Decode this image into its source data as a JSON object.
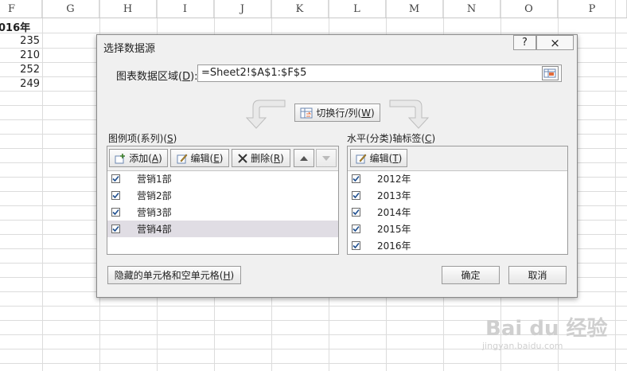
{
  "sheet": {
    "columns": [
      "F",
      "G",
      "H",
      "I",
      "J",
      "K",
      "L",
      "M",
      "N",
      "O",
      "P"
    ],
    "column_f_header": "016年",
    "column_f_values": [
      "235",
      "210",
      "252",
      "249"
    ]
  },
  "dialog": {
    "title": "选择数据源",
    "help_label": "?",
    "close_label": "×",
    "range_label_prefix": "图表数据区域(",
    "range_label_key": "D",
    "range_label_suffix": "):",
    "range_value": "=Sheet2!$A$1:$F$5",
    "switch_button": {
      "prefix": "切换行/列(",
      "key": "W",
      "suffix": ")"
    },
    "legend_panel": {
      "title_prefix": "图例项(系列)(",
      "title_key": "S",
      "title_suffix": ")",
      "add": {
        "prefix": "添加(",
        "key": "A",
        "suffix": ")"
      },
      "edit": {
        "prefix": "编辑(",
        "key": "E",
        "suffix": ")"
      },
      "remove": {
        "prefix": "删除(",
        "key": "R",
        "suffix": ")"
      },
      "items": [
        {
          "label": "营销1部",
          "checked": true
        },
        {
          "label": "营销2部",
          "checked": true
        },
        {
          "label": "营销3部",
          "checked": true
        },
        {
          "label": "营销4部",
          "checked": true,
          "selected": true
        }
      ]
    },
    "axis_panel": {
      "title_prefix": "水平(分类)轴标签(",
      "title_key": "C",
      "title_suffix": ")",
      "edit": {
        "prefix": "编辑(",
        "key": "T",
        "suffix": ")"
      },
      "items": [
        {
          "label": "2012年",
          "checked": true
        },
        {
          "label": "2013年",
          "checked": true
        },
        {
          "label": "2014年",
          "checked": true
        },
        {
          "label": "2015年",
          "checked": true
        },
        {
          "label": "2016年",
          "checked": true
        }
      ]
    },
    "hidden_cells_button": {
      "prefix": "隐藏的单元格和空单元格(",
      "key": "H",
      "suffix": ")"
    },
    "ok_label": "确定",
    "cancel_label": "取消"
  },
  "watermark": {
    "text": "Bai du 经验",
    "sub": "jingyan.baidu.com"
  }
}
